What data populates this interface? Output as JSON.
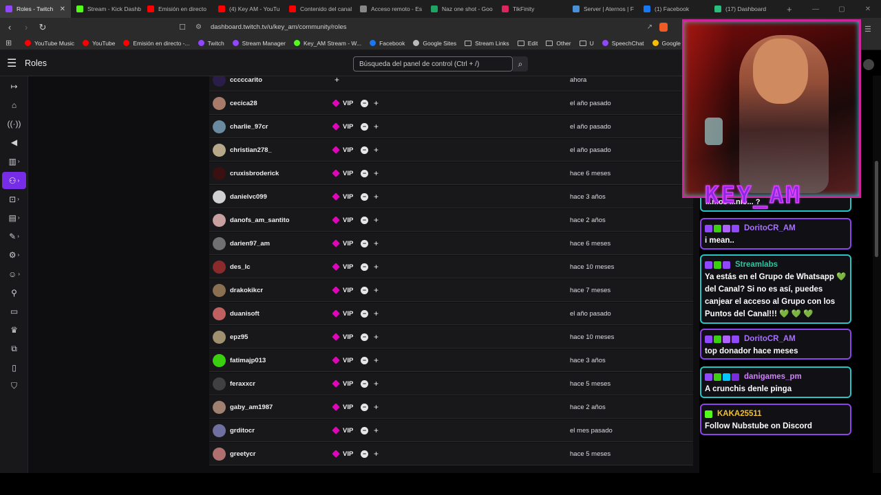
{
  "tabs": [
    {
      "label": "Roles - Twitch",
      "color": "#9146ff",
      "active": true
    },
    {
      "label": "Stream - Kick Dashb",
      "color": "#53fc18"
    },
    {
      "label": "Emisión en directo",
      "color": "#ff0000"
    },
    {
      "label": "(4) Key AM - YouTu",
      "color": "#ff0000"
    },
    {
      "label": "Contenido del canal",
      "color": "#ff0000"
    },
    {
      "label": "Acceso remoto - Es",
      "color": "#888888"
    },
    {
      "label": "Naz one shot - Goo",
      "color": "#1fa463"
    },
    {
      "label": "TikFinity",
      "color": "#e0245e"
    },
    {
      "label": "Server | Aternos | F",
      "color": "#4a90d9"
    },
    {
      "label": "(1) Facebook",
      "color": "#1877f2"
    },
    {
      "label": "(17) Dashboard",
      "color": "#2bbd7e"
    }
  ],
  "address": {
    "url": "dashboard.twitch.tv/u/key_am/community/roles"
  },
  "bookmarks": [
    {
      "label": "YouTube Music",
      "color": "#ff0000"
    },
    {
      "label": "YouTube",
      "color": "#ff0000"
    },
    {
      "label": "Emisión en directo -...",
      "color": "#ff0000"
    },
    {
      "label": "Twitch",
      "color": "#9146ff"
    },
    {
      "label": "Stream Manager",
      "color": "#9146ff"
    },
    {
      "label": "Key_AM Stream - W...",
      "color": "#53fc18"
    },
    {
      "label": "Facebook",
      "color": "#1877f2"
    },
    {
      "label": "Google Sites",
      "color": "#bbbbbb"
    },
    {
      "label": "Stream Links",
      "folder": true
    },
    {
      "label": "Edit",
      "folder": true
    },
    {
      "label": "Other",
      "folder": true
    },
    {
      "label": "U",
      "folder": true
    },
    {
      "label": "SpeechChat",
      "color": "#9146ff"
    },
    {
      "label": "Google Drive",
      "color": "#fbbc04"
    }
  ],
  "header": {
    "title": "Roles",
    "search_placeholder": "Búsqueda del panel de control (Ctrl + /)"
  },
  "roles": [
    {
      "user": "cccccarito",
      "vip": false,
      "when": "ahora",
      "avatar": "#2a1d4a"
    },
    {
      "user": "cecica28",
      "vip": true,
      "when": "el año pasado",
      "avatar": "#a87a6a"
    },
    {
      "user": "charlie_97cr",
      "vip": true,
      "when": "el año pasado",
      "avatar": "#6a8aa0"
    },
    {
      "user": "christian278_",
      "vip": true,
      "when": "el año pasado",
      "avatar": "#b8a88a"
    },
    {
      "user": "cruxisbroderick",
      "vip": true,
      "when": "hace 6 meses",
      "avatar": "#3a1010"
    },
    {
      "user": "danielvc099",
      "vip": true,
      "when": "hace 3 años",
      "avatar": "#d0d0d0"
    },
    {
      "user": "danofs_am_santito",
      "vip": true,
      "when": "hace 2 años",
      "avatar": "#c8a0a0"
    },
    {
      "user": "darien97_am",
      "vip": true,
      "when": "hace 6 meses",
      "avatar": "#707070"
    },
    {
      "user": "des_lc",
      "vip": true,
      "when": "hace 10 meses",
      "avatar": "#8a2a2a"
    },
    {
      "user": "drakokikcr",
      "vip": true,
      "when": "hace 7 meses",
      "avatar": "#8a7050"
    },
    {
      "user": "duanisoft",
      "vip": true,
      "when": "el año pasado",
      "avatar": "#c06060"
    },
    {
      "user": "epz95",
      "vip": true,
      "when": "hace 10 meses",
      "avatar": "#a09070"
    },
    {
      "user": "fatimajp013",
      "vip": true,
      "when": "hace 3 años",
      "avatar": "#3ad010"
    },
    {
      "user": "feraxxcr",
      "vip": true,
      "when": "hace 5 meses",
      "avatar": "#404040"
    },
    {
      "user": "gaby_am1987",
      "vip": true,
      "when": "hace 2 años",
      "avatar": "#a08070"
    },
    {
      "user": "grditocr",
      "vip": true,
      "when": "el mes pasado",
      "avatar": "#7070a0"
    },
    {
      "user": "greetycr",
      "vip": true,
      "when": "hace 5 meses",
      "avatar": "#b07070"
    }
  ],
  "role_label": "VIP",
  "overlay": {
    "logo": "KEY_AM",
    "partial_msg": "...mos ...nio... ?"
  },
  "chat": [
    {
      "user": "DoritoCR_AM",
      "user_color": "#a970ff",
      "msg": "i mean..",
      "border": "purple",
      "badges": [
        "#9146ff",
        "#3ad010",
        "#b060ff",
        "#9146ff"
      ]
    },
    {
      "user": "Streamlabs",
      "user_color": "#31c3a2",
      "msg": "Ya estás en el Grupo de Whatsapp 💚 del Canal? Si no es así, puedes canjear el acceso al Grupo con los Puntos del Canal!!! 💚 💚 💚",
      "border": "teal",
      "badges": [
        "#9146ff",
        "#3ad010",
        "#9146ff"
      ]
    },
    {
      "user": "DoritoCR_AM",
      "user_color": "#a970ff",
      "msg": "top donador hace meses",
      "border": "purple",
      "badges": [
        "#9146ff",
        "#3ad010",
        "#b060ff",
        "#9146ff"
      ]
    },
    {
      "user": "danigames_pm",
      "user_color": "#d080ff",
      "msg": "A crunchis denle pinga",
      "border": "teal",
      "badges": [
        "#9146ff",
        "#3ad010",
        "#00c8ff",
        "#7a2ae0"
      ]
    },
    {
      "user": "KAKA25511",
      "user_color": "#f2c12e",
      "msg": "Follow Nubstube on Discord",
      "border": "purple",
      "badges": [
        "#53fc18"
      ]
    }
  ]
}
